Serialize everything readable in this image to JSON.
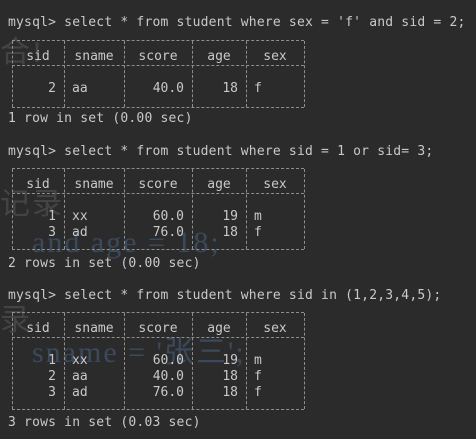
{
  "terminal": {
    "commands": [
      "mysql> select * from student where sex = 'f' and sid = 2;",
      "mysql> select * from student where sid = 1 or sid= 3;",
      "mysql> select * from student where sid in (1,2,3,4,5);"
    ],
    "results": [
      "1 row in set (0.00 sec)",
      "2 rows in set (0.00 sec)",
      "3 rows in set (0.03 sec)"
    ],
    "headers": [
      "sid",
      "sname",
      "score",
      "age",
      "sex"
    ],
    "tables": [
      [
        [
          "2",
          "aa",
          "40.0",
          "18",
          "f"
        ]
      ],
      [
        [
          "1",
          "xx",
          "60.0",
          "19",
          "m"
        ],
        [
          "3",
          "ad",
          "76.0",
          "18",
          "f"
        ]
      ],
      [
        [
          "1",
          "xx",
          "60.0",
          "19",
          "m"
        ],
        [
          "2",
          "aa",
          "40.0",
          "18",
          "f"
        ],
        [
          "3",
          "ad",
          "76.0",
          "18",
          "f"
        ]
      ]
    ],
    "ghost_text": [
      "合!",
      "记录",
      "and age = 18;",
      "录",
      "sname = '张三';"
    ]
  },
  "colors": {
    "background": "#2b2b2b",
    "text": "#c9c9c9",
    "border": "#8e8e8e"
  }
}
